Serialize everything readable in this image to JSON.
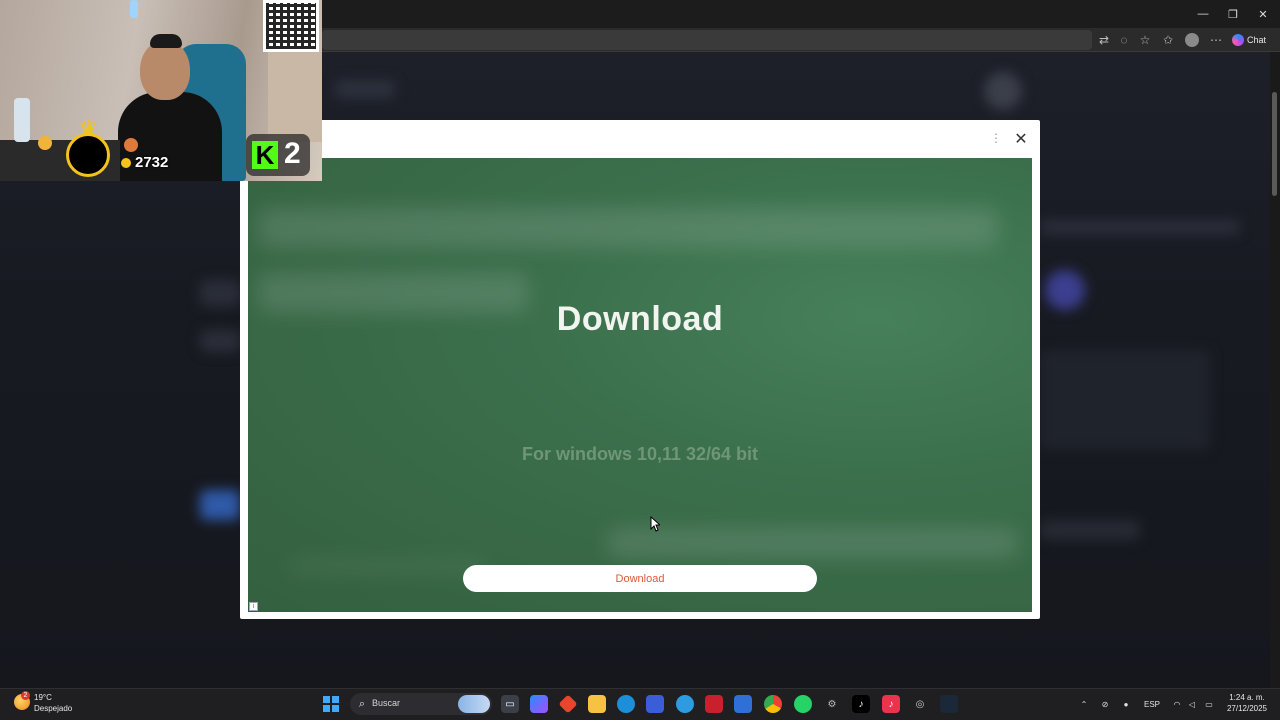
{
  "browser": {
    "window_controls": {
      "minimize": "—",
      "restore": "❐",
      "close": "✕"
    },
    "toolbar_icons": [
      "translate-icon",
      "reader-icon",
      "favorite-star-icon",
      "favorites-icon",
      "profile-icon",
      "more-icon"
    ],
    "chat_label": "Chat"
  },
  "modal": {
    "more_glyph": "⋮",
    "close_glyph": "✕",
    "ad": {
      "title": "Download",
      "subtitle": "For windows 10,11 32/64 bit",
      "button_label": "Download",
      "info_glyph": "i",
      "background_color": "#3b6f4c",
      "button_text_color": "#d9593d"
    }
  },
  "stream_overlay": {
    "coins": "2732",
    "kick_logo": "K",
    "kick_count": "2"
  },
  "taskbar": {
    "weather": {
      "badge": "2",
      "temperature": "19°C",
      "condition": "Despejado"
    },
    "search_placeholder": "Buscar",
    "language": "ESP",
    "time": "1:24 a. m.",
    "date": "27/12/2025"
  }
}
